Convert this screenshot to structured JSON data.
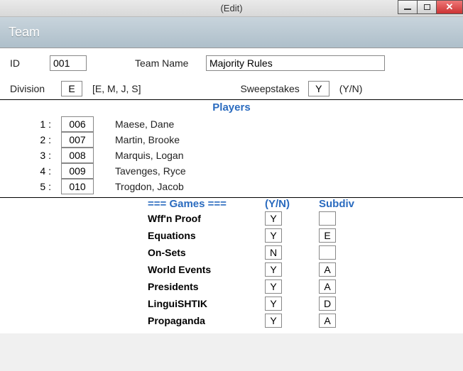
{
  "window": {
    "title": "(Edit)"
  },
  "header": {
    "title": "Team"
  },
  "idRow": {
    "label": "ID",
    "value": "001",
    "teamNameLabel": "Team Name",
    "teamName": "Majority Rules"
  },
  "divRow": {
    "label": "Division",
    "value": "E",
    "hint": "[E, M, J, S]",
    "sweepLabel": "Sweepstakes",
    "sweepValue": "Y",
    "sweepHint": "(Y/N)"
  },
  "playersTitle": "Players",
  "players": [
    {
      "num": "1 :",
      "id": "006",
      "name": "Maese, Dane"
    },
    {
      "num": "2 :",
      "id": "007",
      "name": "Martin, Brooke"
    },
    {
      "num": "3 :",
      "id": "008",
      "name": "Marquis, Logan"
    },
    {
      "num": "4 :",
      "id": "009",
      "name": "Tavenges, Ryce"
    },
    {
      "num": "5 :",
      "id": "010",
      "name": "Trogdon, Jacob"
    }
  ],
  "gamesHeader": {
    "games": "===  Games  ===",
    "yn": "(Y/N)",
    "subdiv": "Subdiv"
  },
  "games": [
    {
      "name": "Wff'n Proof",
      "yn": "Y",
      "subdiv": ""
    },
    {
      "name": "Equations",
      "yn": "Y",
      "subdiv": "E"
    },
    {
      "name": "On-Sets",
      "yn": "N",
      "subdiv": ""
    },
    {
      "name": "World Events",
      "yn": "Y",
      "subdiv": "A"
    },
    {
      "name": "Presidents",
      "yn": "Y",
      "subdiv": "A"
    },
    {
      "name": "LinguiSHTIK",
      "yn": "Y",
      "subdiv": "D"
    },
    {
      "name": "Propaganda",
      "yn": "Y",
      "subdiv": "A"
    }
  ]
}
